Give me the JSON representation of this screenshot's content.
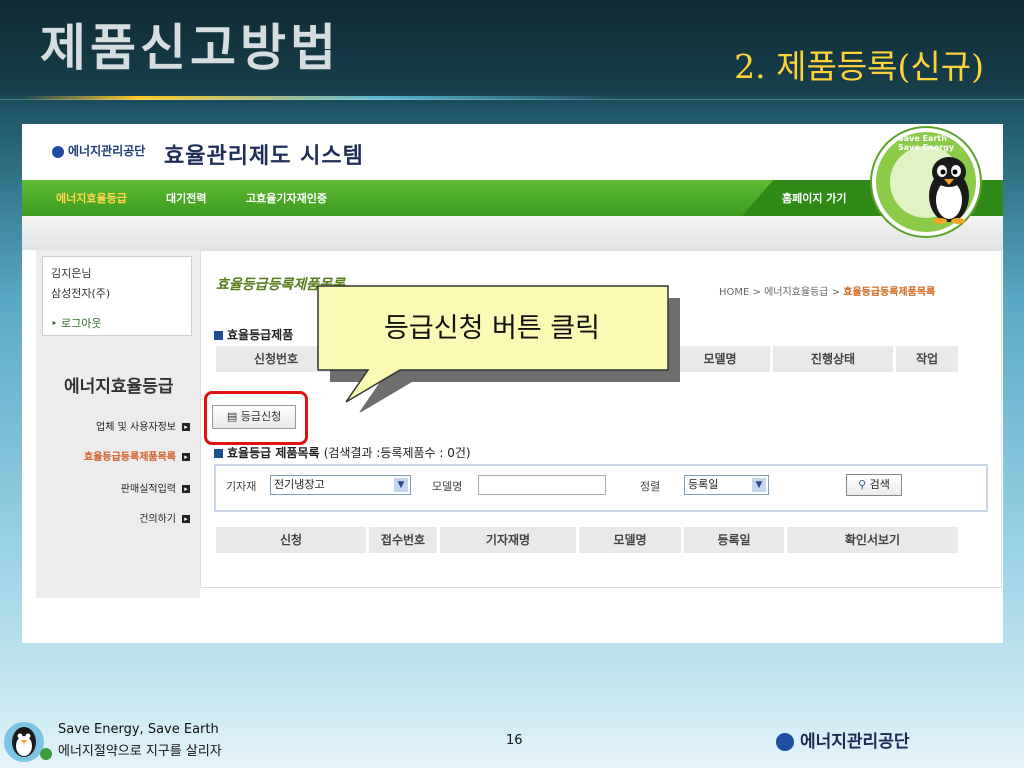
{
  "slide": {
    "title": "제품신고방법",
    "subtitle": "2. 제품등록(신규)",
    "footer_line1": "Save Energy, Save Earth",
    "footer_line2": "에너지절약으로 지구를 살리자",
    "page_number": "16",
    "footer_logo": "에너지관리공단"
  },
  "site": {
    "org_logo": "에너지관리공단",
    "system_title": "효율관리제도 시스템",
    "nav": [
      "에너지효율등급",
      "대기전력",
      "고효율기자재인증"
    ],
    "homepage_link": "홈페이지 가기",
    "badge_text": "Save Earth · Save Energy"
  },
  "sidebar": {
    "user_name": "김지은님",
    "company": "삼성전자(주)",
    "logout": "로그아웃",
    "section_title": "에너지효율등급",
    "links": [
      "업체 및 사용자정보",
      "효율등급등록제품목록",
      "판매실적입력",
      "건의하기"
    ],
    "active_index": 1
  },
  "main": {
    "page_heading": "효율등급등록제품목록",
    "breadcrumb_prefix": "HOME > 에너지효율등급 > ",
    "breadcrumb_current": "효율등급등록제품목록",
    "section1_title": "효율등급제품",
    "table1_headers": [
      "신청번호",
      "모델명",
      "진행상태",
      "작업"
    ],
    "apply_button": "등급신청",
    "section2_title": "효율등급 제품목록",
    "section2_note": "(검색결과 :등록제품수 : 0건)",
    "search": {
      "equipment_label": "기자재",
      "equipment_value": "전기냉장고",
      "model_label": "모델명",
      "model_value": "",
      "sort_label": "정렬",
      "sort_value": "등록일",
      "search_button": "검색"
    },
    "table2_headers": [
      "신청",
      "접수번호",
      "기자재명",
      "모델명",
      "등록일",
      "확인서보기"
    ]
  },
  "callout": {
    "text": "등급신청 버튼 클릭",
    "fill": "#fafab4",
    "border": "#333333"
  },
  "colors": {
    "title_yellow": "#ffd23a",
    "nav_green": "#4aa82a",
    "highlight_red": "#e01212",
    "accent_orange": "#d4602a"
  }
}
